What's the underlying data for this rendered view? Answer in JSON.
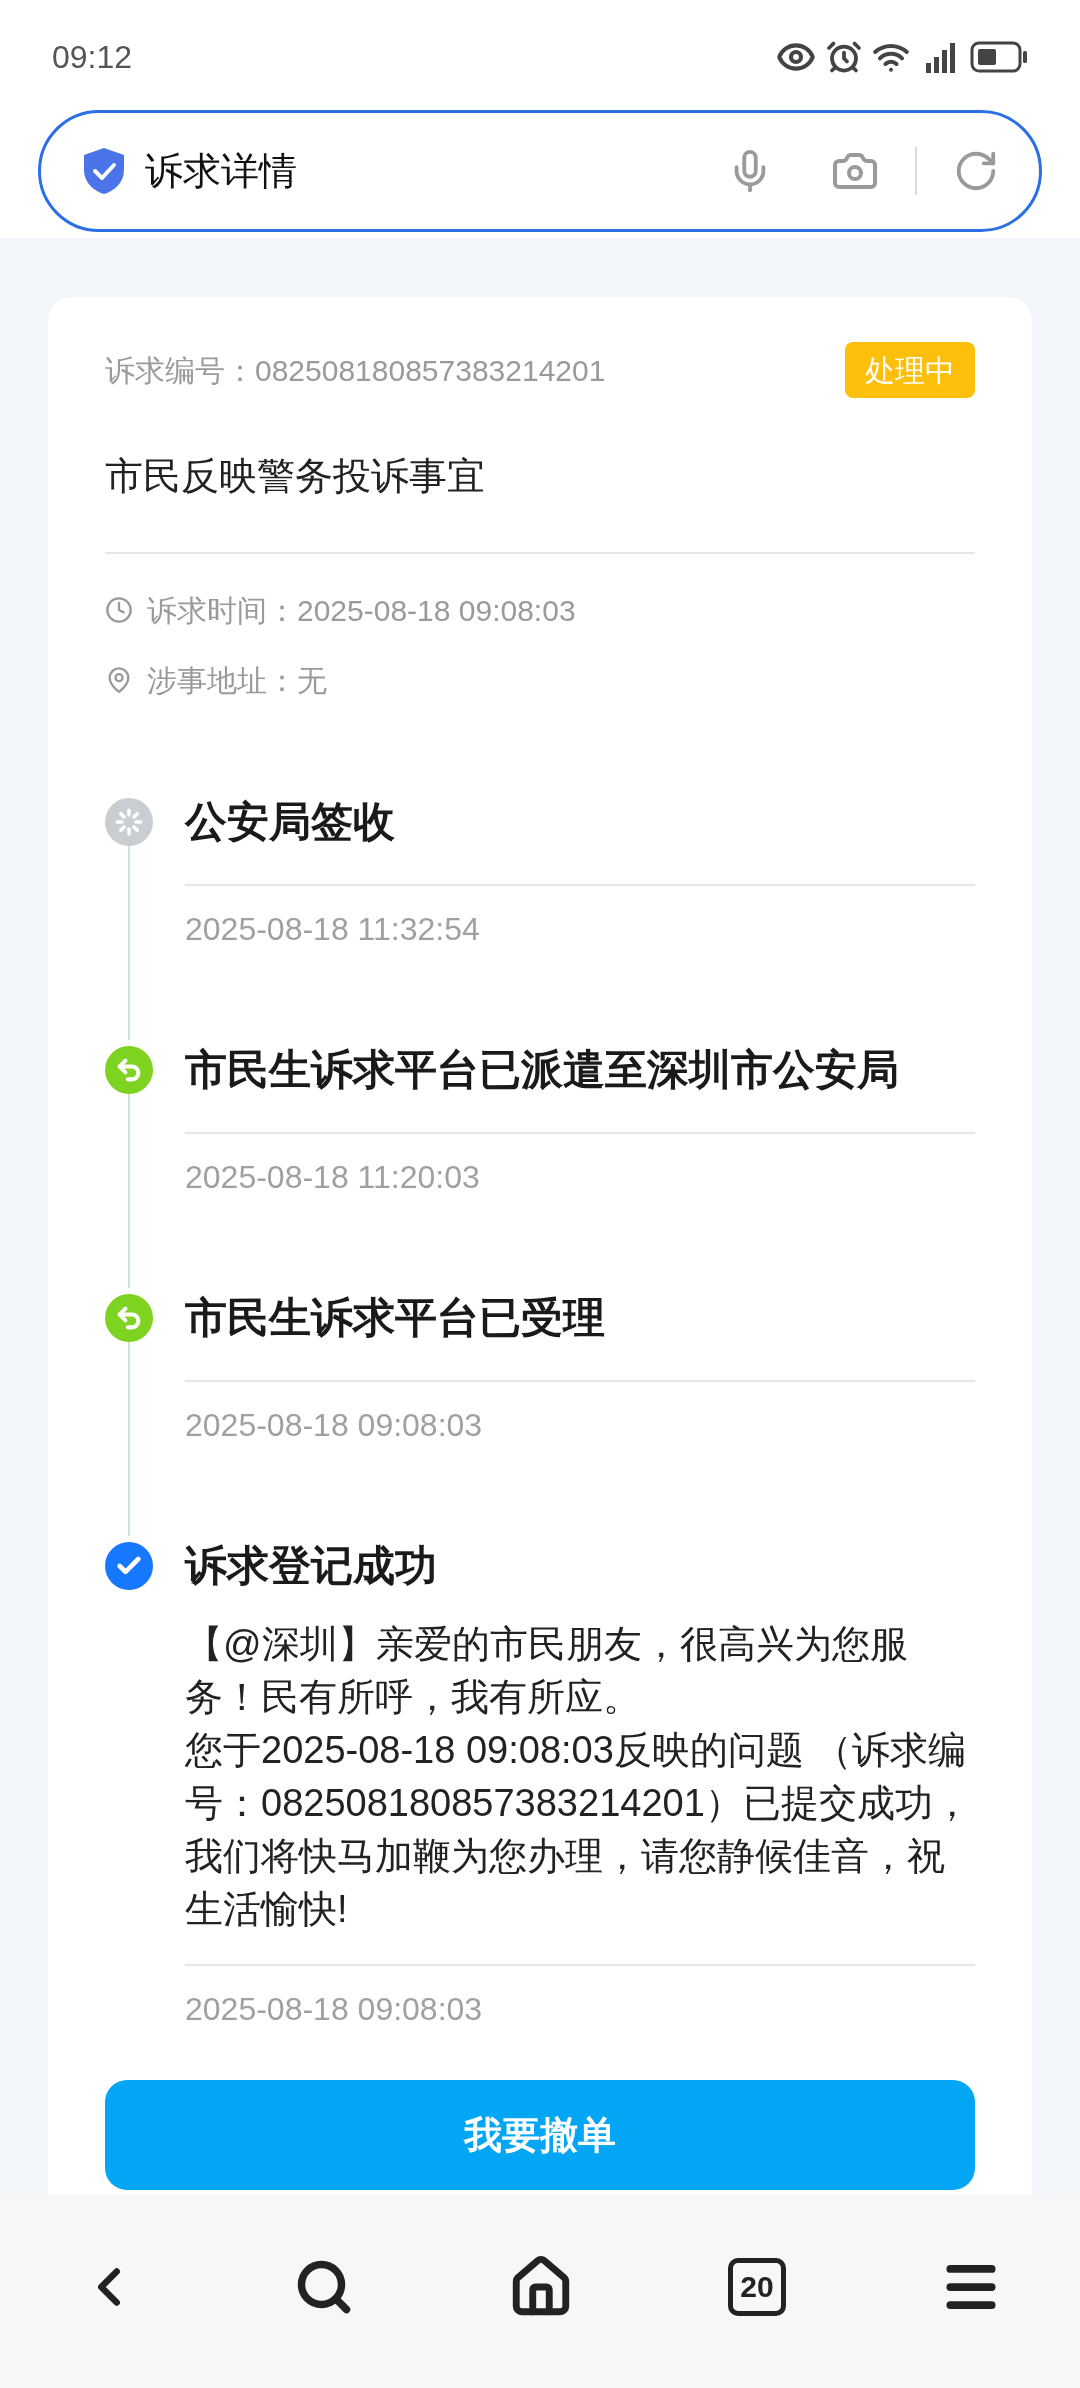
{
  "status_bar": {
    "time": "09:12"
  },
  "search_bar": {
    "title": "诉求详情"
  },
  "request": {
    "number": "诉求编号：082508180857383214201",
    "status": "处理中",
    "subject": "市民反映警务投诉事宜",
    "details": [
      {
        "kind": "time",
        "text": "诉求时间：2025-08-18 09:08:03"
      },
      {
        "kind": "address",
        "text": "涉事地址：无"
      }
    ]
  },
  "timeline": [
    {
      "kind": "pending",
      "title": "公安局签收",
      "time": "2025-08-18 11:32:54"
    },
    {
      "kind": "forwarded",
      "title": "市民生诉求平台已派遣至深圳市公安局",
      "time": "2025-08-18 11:20:03"
    },
    {
      "kind": "forwarded",
      "title": "市民生诉求平台已受理",
      "time": "2025-08-18 09:08:03"
    },
    {
      "kind": "done",
      "title": "诉求登记成功",
      "message": [
        "【@深圳】亲爱的市民朋友，很高兴为您服务！民有所呼，我有所应。",
        "您于2025-08-18 09:08:03反映的问题 （诉求编号：082508180857383214201）已提交成功，我们将快马加鞭为您办理，请您静候佳音，祝生活愉快!"
      ],
      "time": "2025-08-18 09:08:03"
    }
  ],
  "action_button": "我要撤单",
  "bottom_nav": {
    "tab_count": "20"
  }
}
